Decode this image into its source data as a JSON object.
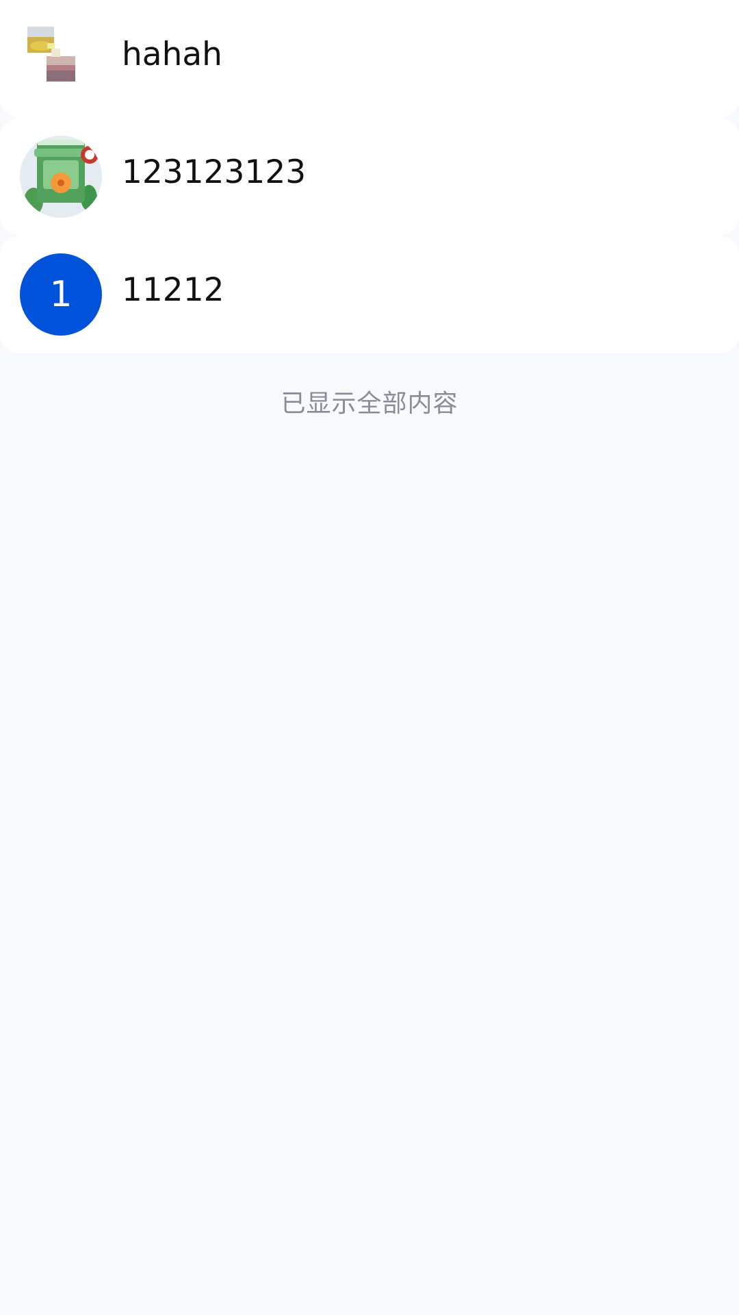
{
  "list": {
    "items": [
      {
        "title": "hahah",
        "avatar_type": "photo-collage"
      },
      {
        "title": "123123123",
        "avatar_type": "paint-bucket-photo"
      },
      {
        "title": "11212",
        "avatar_type": "letter",
        "avatar_letter": "1",
        "avatar_color": "#0052d9"
      }
    ]
  },
  "footer": {
    "text": "已显示全部内容"
  },
  "colors": {
    "background": "#f8f9fc",
    "card": "#ffffff",
    "primary": "#0052d9",
    "footer_text": "#888d95"
  }
}
